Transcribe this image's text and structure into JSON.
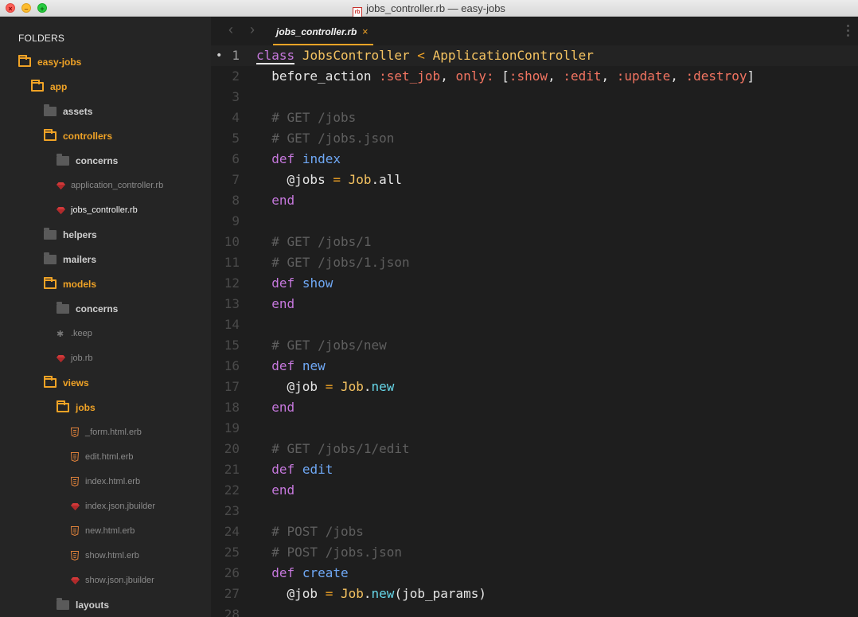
{
  "window": {
    "title": "jobs_controller.rb — easy-jobs",
    "title_badge": "rb"
  },
  "sidebar": {
    "heading": "FOLDERS",
    "tree": [
      {
        "label": "easy-jobs",
        "kind": "folder-open",
        "depth": 0
      },
      {
        "label": "app",
        "kind": "folder-open",
        "depth": 1
      },
      {
        "label": "assets",
        "kind": "folder-closed",
        "depth": 2
      },
      {
        "label": "controllers",
        "kind": "folder-open",
        "depth": 2
      },
      {
        "label": "concerns",
        "kind": "folder-closed",
        "depth": 3
      },
      {
        "label": "application_controller.rb",
        "kind": "ruby",
        "depth": 3
      },
      {
        "label": "jobs_controller.rb",
        "kind": "ruby-active",
        "depth": 3
      },
      {
        "label": "helpers",
        "kind": "folder-closed",
        "depth": 2
      },
      {
        "label": "mailers",
        "kind": "folder-closed",
        "depth": 2
      },
      {
        "label": "models",
        "kind": "folder-open",
        "depth": 2
      },
      {
        "label": "concerns",
        "kind": "folder-closed",
        "depth": 3
      },
      {
        "label": ".keep",
        "kind": "generic",
        "depth": 3
      },
      {
        "label": "job.rb",
        "kind": "ruby",
        "depth": 3
      },
      {
        "label": "views",
        "kind": "folder-open",
        "depth": 2
      },
      {
        "label": "jobs",
        "kind": "folder-open",
        "depth": 3
      },
      {
        "label": "_form.html.erb",
        "kind": "html",
        "depth": 4
      },
      {
        "label": "edit.html.erb",
        "kind": "html",
        "depth": 4
      },
      {
        "label": "index.html.erb",
        "kind": "html",
        "depth": 4
      },
      {
        "label": "index.json.jbuilder",
        "kind": "ruby",
        "depth": 4
      },
      {
        "label": "new.html.erb",
        "kind": "html",
        "depth": 4
      },
      {
        "label": "show.html.erb",
        "kind": "html",
        "depth": 4
      },
      {
        "label": "show.json.jbuilder",
        "kind": "ruby",
        "depth": 4
      },
      {
        "label": "layouts",
        "kind": "folder-closed",
        "depth": 3
      }
    ]
  },
  "tabs": [
    {
      "label": "jobs_controller.rb",
      "close": "×",
      "active": true
    }
  ],
  "nav": {
    "back": "‹",
    "forward": "›"
  },
  "editor": {
    "current_line": 1,
    "line_numbers": [
      "1",
      "2",
      "3",
      "4",
      "5",
      "6",
      "7",
      "8",
      "9",
      "10",
      "11",
      "12",
      "13",
      "14",
      "15",
      "16",
      "17",
      "18",
      "19",
      "20",
      "21",
      "22",
      "23",
      "24",
      "25",
      "26",
      "27",
      "28"
    ],
    "lines": [
      [
        {
          "t": "class",
          "c": "k-underline"
        },
        {
          "t": " "
        },
        {
          "t": "JobsController",
          "c": "c"
        },
        {
          "t": " < ",
          "c": "op"
        },
        {
          "t": "ApplicationController",
          "c": "c"
        }
      ],
      [
        {
          "t": "  before_action "
        },
        {
          "t": ":set_job",
          "c": "s"
        },
        {
          "t": ", "
        },
        {
          "t": "only:",
          "c": "s"
        },
        {
          "t": " ["
        },
        {
          "t": ":show",
          "c": "s"
        },
        {
          "t": ", "
        },
        {
          "t": ":edit",
          "c": "s"
        },
        {
          "t": ", "
        },
        {
          "t": ":update",
          "c": "s"
        },
        {
          "t": ", "
        },
        {
          "t": ":destroy",
          "c": "s"
        },
        {
          "t": "]"
        }
      ],
      [],
      [
        {
          "t": "  # GET /jobs",
          "c": "cm"
        }
      ],
      [
        {
          "t": "  # GET /jobs.json",
          "c": "cm"
        }
      ],
      [
        {
          "t": "  "
        },
        {
          "t": "def",
          "c": "k"
        },
        {
          "t": " "
        },
        {
          "t": "index",
          "c": "f"
        }
      ],
      [
        {
          "t": "    @jobs "
        },
        {
          "t": "=",
          "c": "op"
        },
        {
          "t": " "
        },
        {
          "t": "Job",
          "c": "c"
        },
        {
          "t": ".all"
        }
      ],
      [
        {
          "t": "  "
        },
        {
          "t": "end",
          "c": "k"
        }
      ],
      [],
      [
        {
          "t": "  # GET /jobs/1",
          "c": "cm"
        }
      ],
      [
        {
          "t": "  # GET /jobs/1.json",
          "c": "cm"
        }
      ],
      [
        {
          "t": "  "
        },
        {
          "t": "def",
          "c": "k"
        },
        {
          "t": " "
        },
        {
          "t": "show",
          "c": "f"
        }
      ],
      [
        {
          "t": "  "
        },
        {
          "t": "end",
          "c": "k"
        }
      ],
      [],
      [
        {
          "t": "  # GET /jobs/new",
          "c": "cm"
        }
      ],
      [
        {
          "t": "  "
        },
        {
          "t": "def",
          "c": "k"
        },
        {
          "t": " "
        },
        {
          "t": "new",
          "c": "f"
        }
      ],
      [
        {
          "t": "    @job "
        },
        {
          "t": "=",
          "c": "op"
        },
        {
          "t": " "
        },
        {
          "t": "Job",
          "c": "c"
        },
        {
          "t": "."
        },
        {
          "t": "new",
          "c": "mth"
        }
      ],
      [
        {
          "t": "  "
        },
        {
          "t": "end",
          "c": "k"
        }
      ],
      [],
      [
        {
          "t": "  # GET /jobs/1/edit",
          "c": "cm"
        }
      ],
      [
        {
          "t": "  "
        },
        {
          "t": "def",
          "c": "k"
        },
        {
          "t": " "
        },
        {
          "t": "edit",
          "c": "f"
        }
      ],
      [
        {
          "t": "  "
        },
        {
          "t": "end",
          "c": "k"
        }
      ],
      [],
      [
        {
          "t": "  # POST /jobs",
          "c": "cm"
        }
      ],
      [
        {
          "t": "  # POST /jobs.json",
          "c": "cm"
        }
      ],
      [
        {
          "t": "  "
        },
        {
          "t": "def",
          "c": "k"
        },
        {
          "t": " "
        },
        {
          "t": "create",
          "c": "f"
        }
      ],
      [
        {
          "t": "    @job "
        },
        {
          "t": "=",
          "c": "op"
        },
        {
          "t": " "
        },
        {
          "t": "Job",
          "c": "c"
        },
        {
          "t": "."
        },
        {
          "t": "new",
          "c": "mth"
        },
        {
          "t": "(job_params)"
        }
      ],
      []
    ]
  },
  "colors": {
    "accent": "#f0a326",
    "background": "#1e1e1e",
    "sidebar": "#252525",
    "keyword": "#c678dd",
    "class": "#f5c361",
    "function": "#6fa8f5",
    "symbol": "#f27461",
    "comment": "#5f5f5f"
  }
}
